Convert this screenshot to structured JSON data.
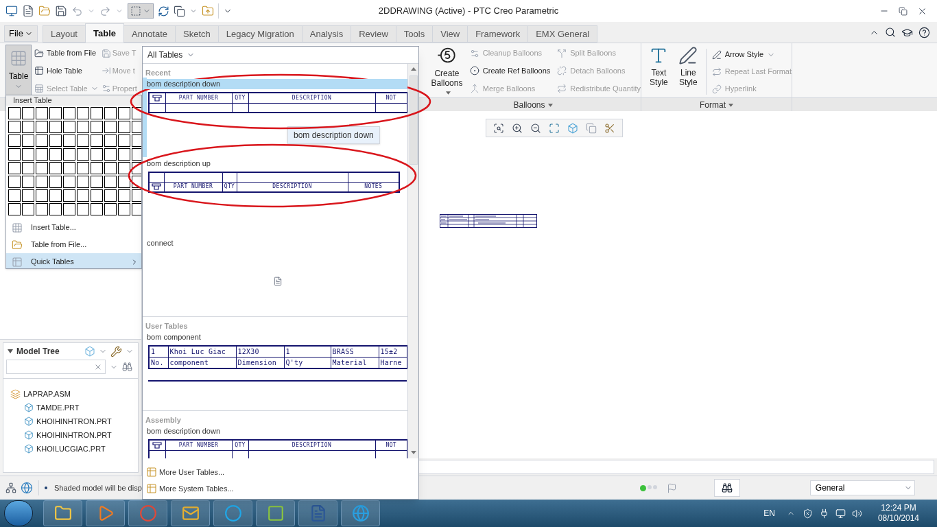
{
  "window": {
    "title": "2DDRAWING (Active) - PTC Creo Parametric"
  },
  "tabs": [
    {
      "label": "File",
      "kind": "menu",
      "selected": false
    },
    {
      "label": "Layout",
      "kind": "tab",
      "selected": false
    },
    {
      "label": "Table",
      "kind": "tab",
      "selected": true
    },
    {
      "label": "Annotate",
      "kind": "tab",
      "selected": false
    },
    {
      "label": "Sketch",
      "kind": "tab",
      "selected": false
    },
    {
      "label": "Legacy Migration",
      "kind": "tab",
      "selected": false
    },
    {
      "label": "Analysis",
      "kind": "tab",
      "selected": false
    },
    {
      "label": "Review",
      "kind": "tab",
      "selected": false
    },
    {
      "label": "Tools",
      "kind": "tab",
      "selected": false
    },
    {
      "label": "View",
      "kind": "tab",
      "selected": false
    },
    {
      "label": "Framework",
      "kind": "tab",
      "selected": false
    },
    {
      "label": "EMX General",
      "kind": "tab",
      "selected": false
    }
  ],
  "ribbon": {
    "table_group": {
      "button": {
        "label": "Table",
        "menu": true,
        "pressed": true
      },
      "items": [
        {
          "label": "Table from File",
          "disabled": false,
          "menu": false
        },
        {
          "label": "Hole Table",
          "disabled": false,
          "menu": false
        },
        {
          "label": "Select Table",
          "disabled": true,
          "menu": true
        },
        {
          "label": "Save T",
          "disabled": true,
          "menu": false
        },
        {
          "label": "Move t",
          "disabled": true,
          "menu": false
        },
        {
          "label": "Propert",
          "disabled": true,
          "menu": false
        }
      ]
    },
    "balloons_group": {
      "label": "Balloons",
      "button": {
        "label": "Create Balloons",
        "menu": true
      },
      "items": [
        {
          "label": "Cleanup Balloons",
          "disabled": true,
          "menu": false
        },
        {
          "label": "Create Ref Balloons",
          "disabled": false,
          "menu": false
        },
        {
          "label": "Merge Balloons",
          "disabled": true,
          "menu": false
        },
        {
          "label": "Split Balloons",
          "disabled": true,
          "menu": false
        },
        {
          "label": "Detach Balloons",
          "disabled": true,
          "menu": false
        },
        {
          "label": "Redistribute Quantity",
          "disabled": true,
          "menu": false
        }
      ]
    },
    "format_group": {
      "label": "Format",
      "buttons": [
        {
          "label": "Text Style"
        },
        {
          "label": "Line Style"
        }
      ],
      "items": [
        {
          "label": "Arrow Style",
          "disabled": false,
          "menu": true
        },
        {
          "label": "Repeat Last Format",
          "disabled": true,
          "menu": false
        },
        {
          "label": "Hyperlink",
          "disabled": true,
          "menu": false
        }
      ]
    }
  },
  "insert_table_menu": {
    "title": "Insert Table",
    "items": [
      {
        "label": "Insert Table...",
        "selected": false,
        "submenu": false
      },
      {
        "label": "Table from File...",
        "selected": false,
        "submenu": false
      },
      {
        "label": "Quick Tables",
        "selected": true,
        "submenu": true
      }
    ]
  },
  "quick_tables": {
    "filter": "All Tables",
    "sections": [
      {
        "title": "Recent",
        "entries": [
          {
            "name": "bom description down",
            "selected": true,
            "preview": {
              "kind": "bom",
              "header_first": true,
              "columns": [
                "PART NUMBER",
                "QTY",
                "DESCRIPTION",
                "NOT"
              ]
            }
          },
          {
            "name": "bom description up",
            "selected": false,
            "preview": {
              "kind": "bom",
              "header_first": false,
              "columns": [
                "PART NUMBER",
                "QTY",
                "DESCRIPTION",
                "NOTES"
              ]
            }
          },
          {
            "name": "connect",
            "selected": false,
            "preview": {
              "kind": "file"
            }
          }
        ]
      },
      {
        "title": "User Tables",
        "entries": [
          {
            "name": "bom component",
            "selected": false,
            "preview": {
              "kind": "grid",
              "rows": [
                [
                  "1",
                  "Khoi Luc Giac",
                  "12X30",
                  "1",
                  "BRASS",
                  "15±2"
                ],
                [
                  "No.",
                  "component",
                  "Dimension",
                  "Q'ty",
                  "Material",
                  "Harne"
                ]
              ]
            }
          }
        ]
      },
      {
        "title": "Assembly",
        "entries": [
          {
            "name": "bom description down",
            "selected": false,
            "preview": {
              "kind": "bom",
              "header_first": true,
              "columns": [
                "PART NUMBER",
                "QTY",
                "DESCRIPTION",
                "NOT"
              ]
            }
          }
        ]
      }
    ],
    "footer": [
      "More User Tables...",
      "More System Tables..."
    ],
    "tooltip": "bom description down"
  },
  "model_tree": {
    "title": "Model Tree",
    "tree": [
      {
        "label": "LAPRAP.ASM",
        "kind": "assembly",
        "children": [
          {
            "label": "TAMDE.PRT",
            "kind": "part"
          },
          {
            "label": "KHOIHINHTRON.PRT",
            "kind": "part"
          },
          {
            "label": "KHOIHINHTRON.PRT",
            "kind": "part"
          },
          {
            "label": "KHOILUCGIAC.PRT",
            "kind": "part"
          }
        ]
      }
    ]
  },
  "status_bar": {
    "message": "Shaded model will be disp",
    "filter": "General"
  },
  "taskbar": {
    "language": "EN",
    "time": "12:24 PM",
    "date": "08/10/2014"
  }
}
